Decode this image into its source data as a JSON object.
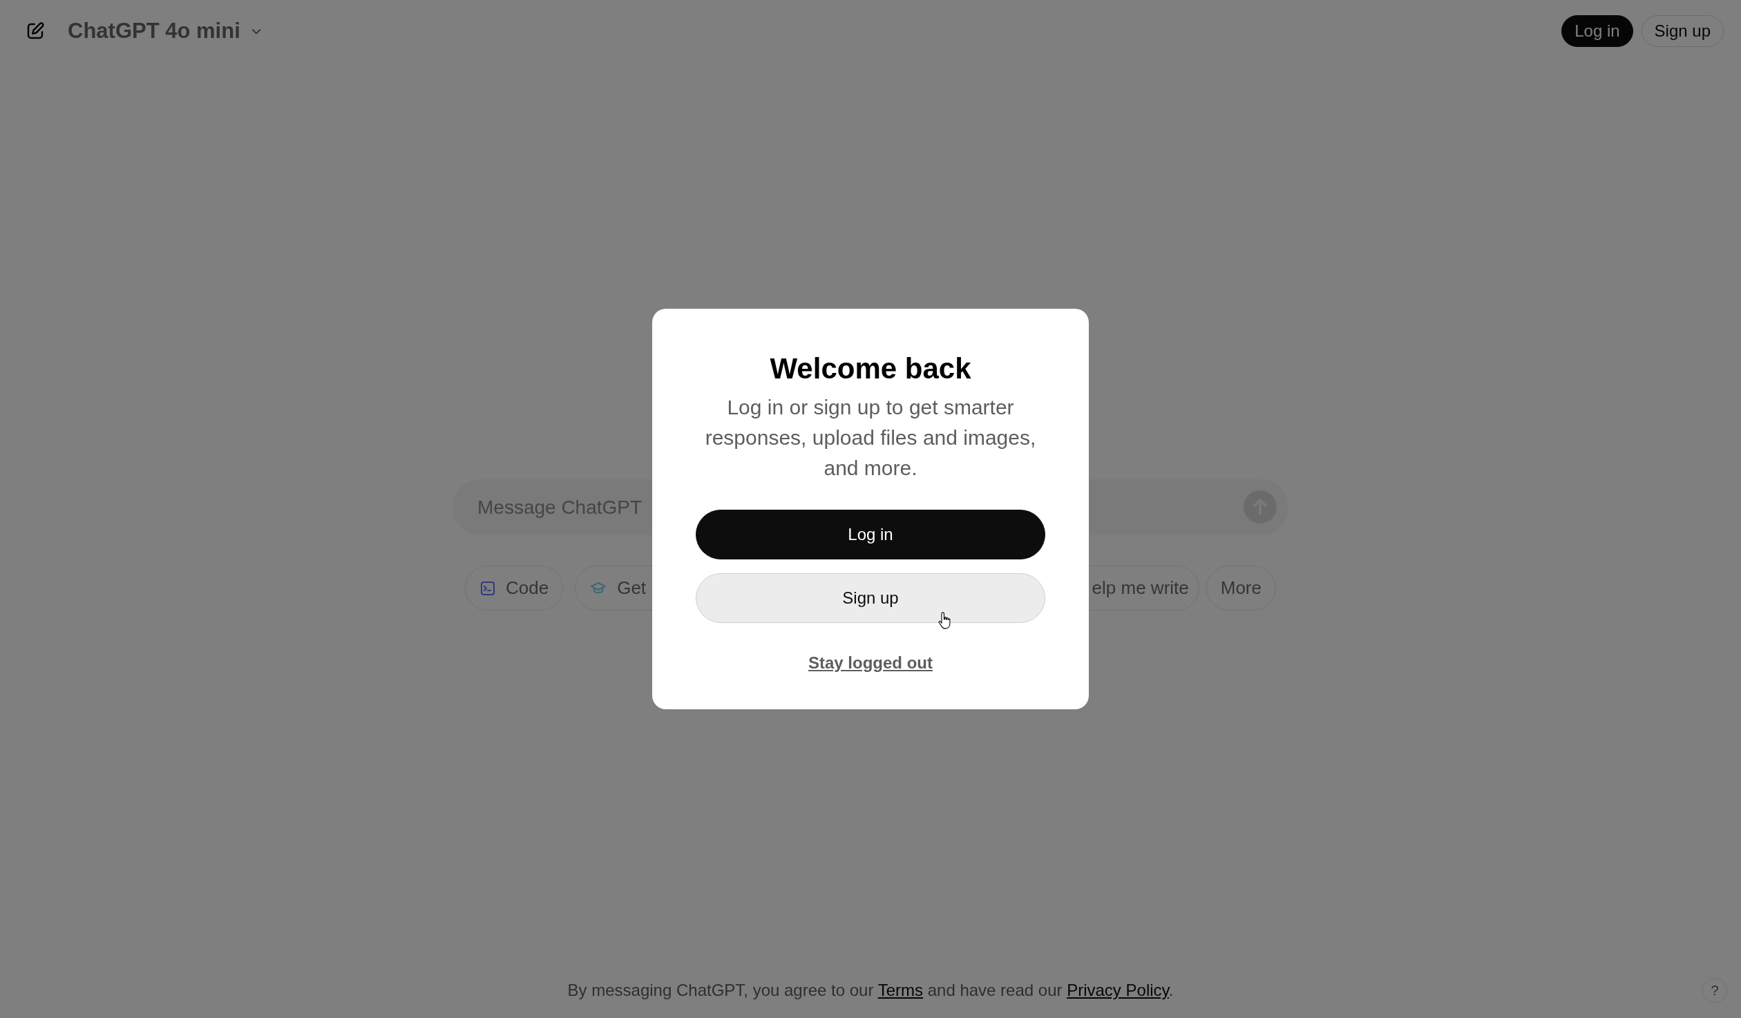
{
  "header": {
    "model_name": "ChatGPT 4o mini",
    "buttons": [
      {
        "label": "Log in",
        "kind": "primary"
      },
      {
        "label": "Sign up",
        "kind": "secondary"
      }
    ]
  },
  "composer": {
    "placeholder": "Message ChatGPT"
  },
  "chips_left": [
    {
      "label": "Code"
    },
    {
      "label": "Get"
    }
  ],
  "chips_right": [
    {
      "label": "elp me write"
    },
    {
      "label": "More"
    }
  ],
  "dialog": {
    "title": "Welcome back",
    "text": "Log in or sign up to get smarter responses, upload files and images, and more.",
    "buttons": [
      {
        "label": "Log in",
        "kind": "primary"
      },
      {
        "label": "Sign up",
        "kind": "secondary"
      }
    ],
    "link": "Stay logged out"
  },
  "footer": {
    "parts": [
      {
        "kind": "text",
        "text": "By messaging ChatGPT, you agree to our "
      },
      {
        "kind": "link",
        "text": "Terms"
      },
      {
        "kind": "text",
        "text": " and have read our "
      },
      {
        "kind": "link",
        "text": "Privacy Policy"
      },
      {
        "kind": "text",
        "text": "."
      }
    ],
    "help": "?"
  }
}
